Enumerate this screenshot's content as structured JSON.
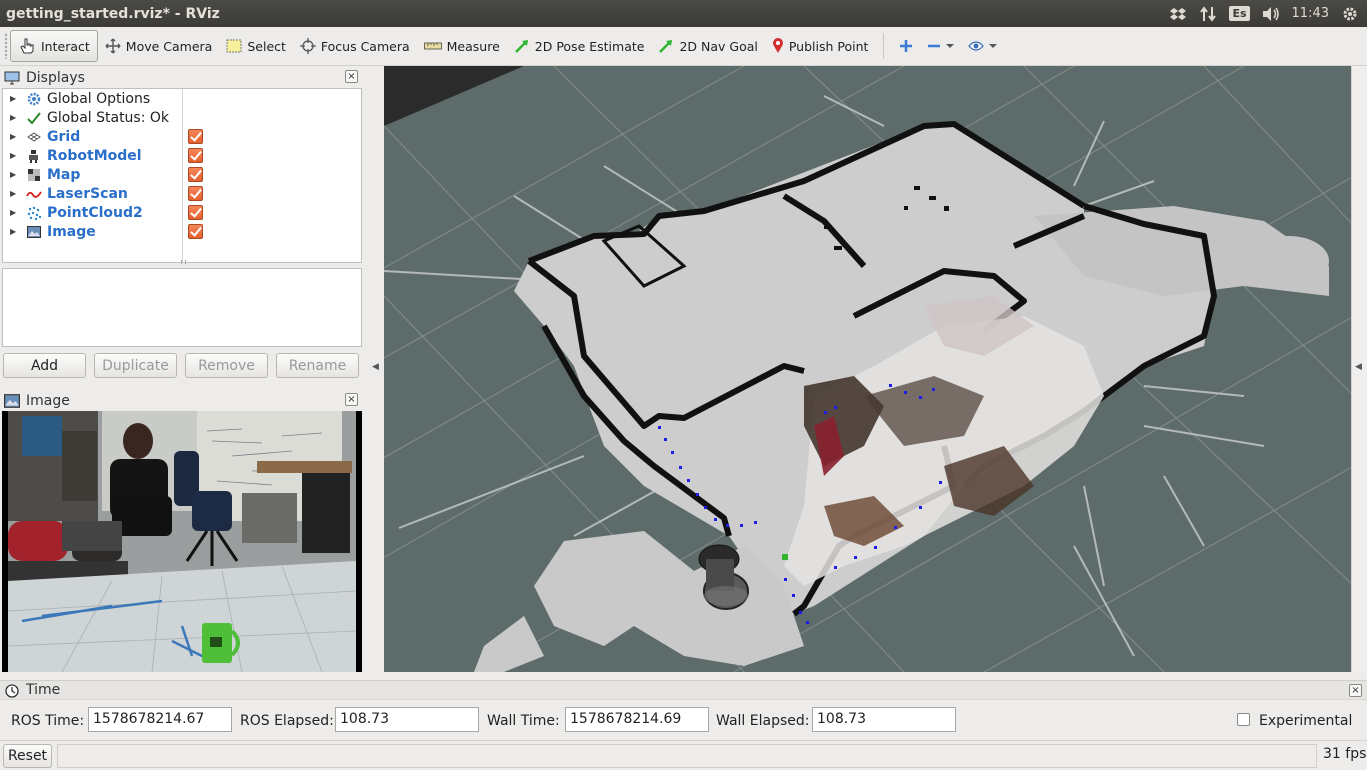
{
  "window": {
    "title": "getting_started.rviz* - RViz"
  },
  "tray": {
    "keyboard": "Es",
    "clock": "11:43"
  },
  "toolbar": {
    "tools": [
      {
        "label": "Interact",
        "icon": "hand-pointer-icon"
      },
      {
        "label": "Move Camera",
        "icon": "move-camera-icon"
      },
      {
        "label": "Select",
        "icon": "select-box-icon"
      },
      {
        "label": "Focus Camera",
        "icon": "crosshair-icon"
      },
      {
        "label": "Measure",
        "icon": "ruler-icon"
      },
      {
        "label": "2D Pose Estimate",
        "icon": "green-arrow-icon"
      },
      {
        "label": "2D Nav Goal",
        "icon": "green-arrow-icon"
      },
      {
        "label": "Publish Point",
        "icon": "map-pin-icon"
      }
    ]
  },
  "displays": {
    "title": "Displays",
    "items": [
      {
        "label": "Global Options",
        "icon": "gear-icon",
        "checked": null
      },
      {
        "label": "Global Status: Ok",
        "icon": "checkmark-icon",
        "checked": null
      },
      {
        "label": "Grid",
        "icon": "grid-icon",
        "checked": true
      },
      {
        "label": "RobotModel",
        "icon": "robot-icon",
        "checked": true
      },
      {
        "label": "Map",
        "icon": "map-icon",
        "checked": true
      },
      {
        "label": "LaserScan",
        "icon": "laser-icon",
        "checked": true
      },
      {
        "label": "PointCloud2",
        "icon": "pointcloud-icon",
        "checked": true
      },
      {
        "label": "Image",
        "icon": "image-icon",
        "checked": true
      }
    ],
    "buttons": {
      "add": "Add",
      "duplicate": "Duplicate",
      "remove": "Remove",
      "rename": "Rename"
    }
  },
  "image_panel": {
    "title": "Image"
  },
  "time": {
    "title": "Time",
    "ros_time_label": "ROS Time:",
    "ros_time": "1578678214.67",
    "ros_elapsed_label": "ROS Elapsed:",
    "ros_elapsed": "108.73",
    "wall_time_label": "Wall Time:",
    "wall_time": "1578678214.69",
    "wall_elapsed_label": "Wall Elapsed:",
    "wall_elapsed": "108.73",
    "experimental_label": "Experimental",
    "experimental_checked": false
  },
  "status": {
    "reset_label": "Reset",
    "fps": "31 fps"
  }
}
